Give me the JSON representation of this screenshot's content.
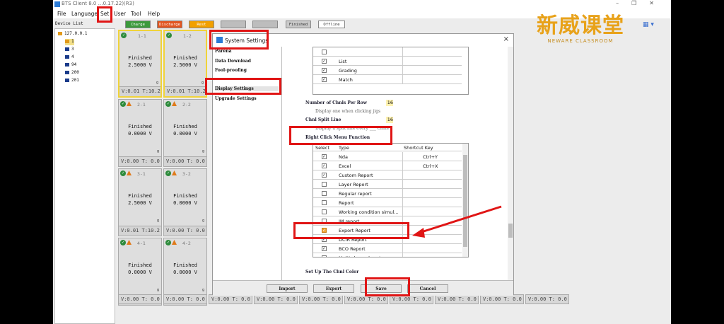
{
  "window": {
    "title": "BTS Client 8.0 …0.17.22)(R3)"
  },
  "menu": [
    "File",
    "Language",
    "Set",
    "User",
    "Tool",
    "Help"
  ],
  "device_list_label": "Device List",
  "toolbar": [
    {
      "label": "Charge",
      "color": "#3c9a3c"
    },
    {
      "label": "Discharge",
      "color": "#e2551f"
    },
    {
      "label": "Rest",
      "color": "#f2a000"
    },
    {
      "label": "",
      "color": "#bdbdbd"
    },
    {
      "label": "",
      "color": "#bdbdbd"
    },
    {
      "label": "Finished",
      "color": "#c9c9c9"
    },
    {
      "label": "Offline",
      "color": "#ffffff"
    }
  ],
  "brand": {
    "title": "新威课堂",
    "subtitle": "NEWARE CLASSROOM"
  },
  "tree": {
    "root": "127.0.0.1",
    "children": [
      "1",
      "3",
      "4",
      "94",
      "200",
      "201"
    ]
  },
  "channels": [
    {
      "id": "1-1",
      "status": "Finished",
      "voltage": "2.5000",
      "unit": "V",
      "footer": "V:0.01  T:10.2",
      "selected": true
    },
    {
      "id": "1-2",
      "status": "Finished",
      "voltage": "2.5000",
      "unit": "V",
      "footer": "V:0.01  T:10.2",
      "selected": true
    },
    {
      "id": "2-1",
      "status": "Finished",
      "voltage": "0.0000",
      "unit": "V",
      "footer": "V:0.00  T: 0.0",
      "selected": false
    },
    {
      "id": "2-2",
      "status": "Finished",
      "voltage": "0.0000",
      "unit": "V",
      "footer": "V:0.00  T: 0.0",
      "selected": false
    },
    {
      "id": "3-1",
      "status": "Finished",
      "voltage": "2.5000",
      "unit": "V",
      "footer": "V:0.01  T:10.2",
      "selected": false
    },
    {
      "id": "3-2",
      "status": "Finished",
      "voltage": "0.0000",
      "unit": "V",
      "footer": "V:0.00  T: 0.0",
      "selected": false
    },
    {
      "id": "4-1",
      "status": "Finished",
      "voltage": "0.0000",
      "unit": "V",
      "footer": "V:0.00  T: 0.0",
      "selected": false
    },
    {
      "id": "4-2",
      "status": "Finished",
      "voltage": "0.0000",
      "unit": "V",
      "footer": "V:0.00  T: 0.0",
      "selected": false
    }
  ],
  "bottom_footer": "V:0.00  T: 0.0",
  "dialog": {
    "title": "System Settings",
    "close": "×",
    "nav": [
      "Parena",
      "Data Download",
      "Fool-proofing",
      "",
      "Display Settings",
      "Upgrade Settings"
    ],
    "active_nav": "Display Settings",
    "top_list": [
      {
        "label": "",
        "checked": false
      },
      {
        "label": "List",
        "checked": true
      },
      {
        "label": "Grading",
        "checked": true
      },
      {
        "label": "Match",
        "checked": true
      }
    ],
    "chnls_per_row_label": "Number of Chnls Per Row",
    "chnls_per_row_value": "16",
    "clicking_jigs_note": "Display one when clicking jigs",
    "split_line_label": "Chnl Split Line",
    "split_line_value": "16",
    "split_note": "Display a split line every ___ chnls",
    "right_click_label": "Right Click Menu Function",
    "menu_table": {
      "headers": [
        "Select",
        "Type",
        "Shortcut Key"
      ],
      "rows": [
        {
          "type": "Nda",
          "shortcut": "Ctrl+Y",
          "checked": true
        },
        {
          "type": "Excel",
          "shortcut": "Ctrl+X",
          "checked": true
        },
        {
          "type": "Custom Report",
          "shortcut": "",
          "checked": true
        },
        {
          "type": "Layer Report",
          "shortcut": "",
          "checked": false
        },
        {
          "type": "Regular report",
          "shortcut": "",
          "checked": false
        },
        {
          "type": "Report",
          "shortcut": "",
          "checked": false
        },
        {
          "type": "Working condition simul…",
          "shortcut": "",
          "checked": false
        },
        {
          "type": "IM report",
          "shortcut": "",
          "checked": false
        },
        {
          "type": "Export Report",
          "shortcut": "",
          "checked": true
        },
        {
          "type": "DCIR Report",
          "shortcut": "",
          "checked": true
        },
        {
          "type": "BCO Report",
          "shortcut": "",
          "checked": true
        },
        {
          "type": "Multi-channel custom re…",
          "shortcut": "",
          "checked": false
        }
      ]
    },
    "chnl_color_label": "Set Up The Chnl Color",
    "buttons": {
      "import": "Import",
      "export": "Export",
      "save": "Save",
      "cancel": "Cancel"
    }
  },
  "colors": {
    "highlight_red": "#e01515",
    "brand_orange": "#e8a21a",
    "selected_border": "#f0d33a"
  }
}
